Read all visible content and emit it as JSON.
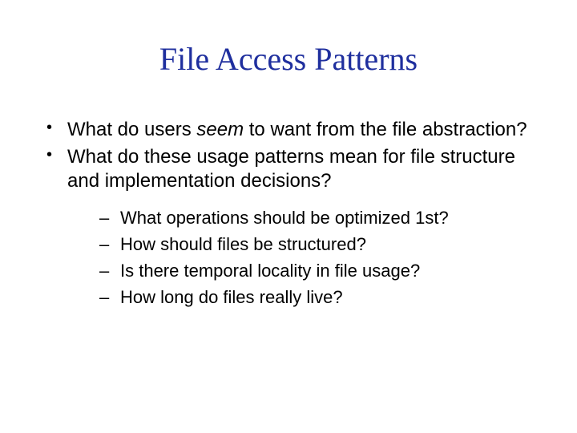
{
  "title": "File Access Patterns",
  "bullets": [
    {
      "pre": "What do users ",
      "em": "seem",
      "post": " to want from the file abstraction?"
    },
    {
      "text": "What do these usage patterns mean for file structure and implementation decisions?"
    }
  ],
  "sub": [
    "What operations should be optimized 1st?",
    "How should files be structured?",
    "Is there temporal locality in file usage?",
    "How long do files really live?"
  ]
}
